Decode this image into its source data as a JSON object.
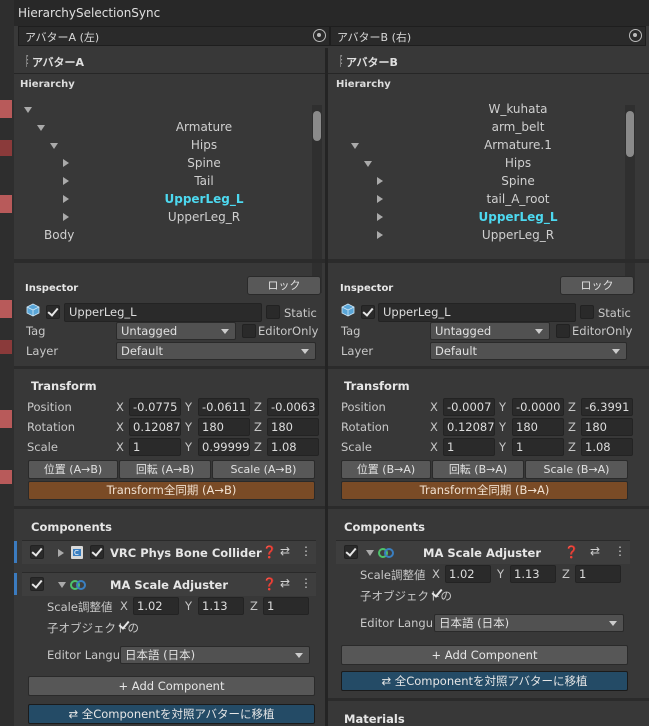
{
  "title": "HierarchySelectionSync",
  "avatarA": {
    "label": "アバターA (左)"
  },
  "avatarB": {
    "label": "アバターB (右)"
  },
  "left": {
    "panel_title": "アバターA",
    "hierarchy_label": "Hierarchy",
    "tree": [
      {
        "label": "",
        "depth": 0,
        "arrow": "down"
      },
      {
        "label": "Armature",
        "depth": 1,
        "arrow": "down"
      },
      {
        "label": "Hips",
        "depth": 2,
        "arrow": "down"
      },
      {
        "label": "Spine",
        "depth": 3,
        "arrow": "right"
      },
      {
        "label": "Tail",
        "depth": 3,
        "arrow": "right"
      },
      {
        "label": "UpperLeg_L",
        "depth": 3,
        "arrow": "right",
        "selected": true
      },
      {
        "label": "UpperLeg_R",
        "depth": 3,
        "arrow": "right"
      },
      {
        "label": "Body",
        "depth": 1,
        "arrow": ""
      }
    ],
    "inspector_label": "Inspector",
    "lock": "ロック",
    "object_name": "UpperLeg_L",
    "static": "Static",
    "tag_label": "Tag",
    "tag_value": "Untagged",
    "editoronly": "EditorOnly",
    "layer_label": "Layer",
    "layer_value": "Default",
    "transform_label": "Transform",
    "position_label": "Position",
    "position": [
      "-0.0775",
      "-0.0611",
      "-0.0063"
    ],
    "rotation_label": "Rotation",
    "rotation": [
      "0.12087",
      "180",
      "180"
    ],
    "scale_label": "Scale",
    "scale": [
      "1",
      "0.99999",
      "1.08"
    ],
    "btn_pos": "位置 (A→B)",
    "btn_rot": "回転 (A→B)",
    "btn_scale": "Scale (A→B)",
    "btn_sync": "Transform全同期 (A→B)",
    "components_label": "Components",
    "comp1": "VRC Phys Bone Collider",
    "comp2": "MA Scale Adjuster",
    "scale_adj_label": "Scale調整値",
    "scale_adj": [
      "1.02",
      "1.13",
      "1"
    ],
    "child_label": "子オブジェクトの",
    "editor_lang_label": "Editor Langu",
    "editor_lang": "日本語 (日本)",
    "add_component": "+ Add Component",
    "move_all": "⇄ 全Componentを対照アバターに移植"
  },
  "right": {
    "panel_title": "アバターB",
    "hierarchy_label": "Hierarchy",
    "tree": [
      {
        "label": "W_kuhata",
        "depth": 1,
        "arrow": ""
      },
      {
        "label": "arm_belt",
        "depth": 1,
        "arrow": ""
      },
      {
        "label": "Armature.1",
        "depth": 1,
        "arrow": "down"
      },
      {
        "label": "Hips",
        "depth": 2,
        "arrow": "down"
      },
      {
        "label": "Spine",
        "depth": 3,
        "arrow": "right"
      },
      {
        "label": "tail_A_root",
        "depth": 3,
        "arrow": "right"
      },
      {
        "label": "UpperLeg_L",
        "depth": 3,
        "arrow": "right",
        "selected": true
      },
      {
        "label": "UpperLeg_R",
        "depth": 3,
        "arrow": "right"
      }
    ],
    "inspector_label": "Inspector",
    "lock": "ロック",
    "object_name": "UpperLeg_L",
    "static": "Static",
    "tag_label": "Tag",
    "tag_value": "Untagged",
    "editoronly": "EditorOnly",
    "layer_label": "Layer",
    "layer_value": "Default",
    "transform_label": "Transform",
    "position_label": "Position",
    "position": [
      "-0.0007",
      "-0.0000",
      "-6.3991"
    ],
    "rotation_label": "Rotation",
    "rotation": [
      "0.12087",
      "180",
      "180"
    ],
    "scale_label": "Scale",
    "scale": [
      "1",
      "1",
      "1.08"
    ],
    "btn_pos": "位置 (B→A)",
    "btn_rot": "回転 (B→A)",
    "btn_scale": "Scale (B→A)",
    "btn_sync": "Transform全同期 (B→A)",
    "components_label": "Components",
    "comp1": "MA Scale Adjuster",
    "scale_adj_label": "Scale調整値",
    "scale_adj": [
      "1.02",
      "1.13",
      "1"
    ],
    "child_label": "子オブジェクトの",
    "editor_lang_label": "Editor Langu",
    "editor_lang": "日本語 (日本)",
    "add_component": "+ Add Component",
    "move_all": "⇄ 全Componentを対照アバターに移植",
    "materials_label": "Materials"
  },
  "axes": {
    "x": "X",
    "y": "Y",
    "z": "Z"
  },
  "colors": {
    "selected": "#4dd9f0",
    "sync_button": "#7a4b26",
    "move_button": "#244b66"
  }
}
